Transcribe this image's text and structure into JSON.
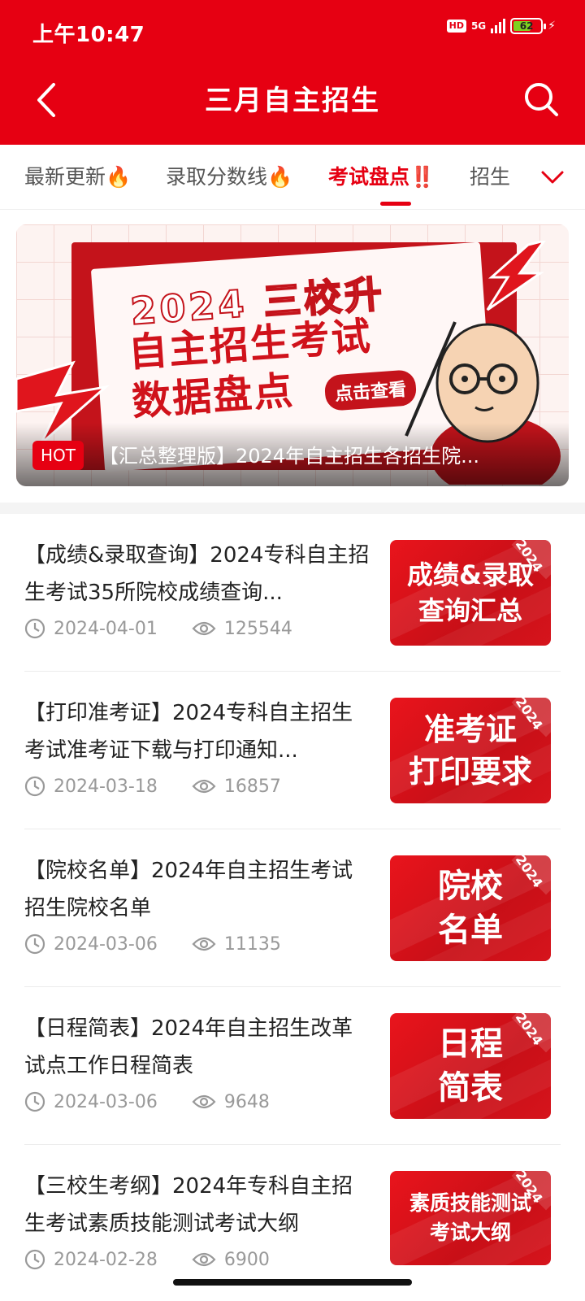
{
  "status_bar": {
    "time": "上午10:47",
    "hd": "HD",
    "network": "5G",
    "battery": "62"
  },
  "nav": {
    "title": "三月自主招生"
  },
  "tabs": [
    {
      "label": "最新更新🔥"
    },
    {
      "label": "录取分数线🔥"
    },
    {
      "label": "考试盘点‼️"
    },
    {
      "label": "招生"
    }
  ],
  "banner": {
    "year_text": "2024 三校升",
    "main_line1": "自主招生考试",
    "main_line2": "数据盘点",
    "cta": "点击查看",
    "hot": "HOT",
    "caption": "【汇总整理版】2024年自主招生各招生院..."
  },
  "articles": [
    {
      "title": "【成绩&录取查询】2024专科自主招生考试35所院校成绩查询...",
      "date": "2024-04-01",
      "views": "125544",
      "thumb": "成绩&录取\n查询汇总",
      "thumb_year": "2024"
    },
    {
      "title": "【打印准考证】2024专科自主招生考试准考证下载与打印通知...",
      "date": "2024-03-18",
      "views": "16857",
      "thumb": "准考证\n打印要求",
      "thumb_year": "2024"
    },
    {
      "title": "【院校名单】2024年自主招生考试招生院校名单",
      "date": "2024-03-06",
      "views": "11135",
      "thumb": "院校\n名单",
      "thumb_year": "2024"
    },
    {
      "title": "【日程简表】2024年自主招生改革试点工作日程简表",
      "date": "2024-03-06",
      "views": "9648",
      "thumb": "日程\n简表",
      "thumb_year": "2024"
    },
    {
      "title": "【三校生考纲】2024年专科自主招生考试素质技能测试考试大纲",
      "date": "2024-02-28",
      "views": "6900",
      "thumb": "素质技能测试\n考试大纲",
      "thumb_year": "2024"
    }
  ],
  "icons": {
    "back": "chevron-left-icon",
    "search": "search-icon",
    "expand": "chevron-down-icon",
    "date": "clock-icon",
    "views": "eye-icon"
  },
  "colors": {
    "brand": "#e60012",
    "text": "#222222",
    "muted": "#999999"
  }
}
